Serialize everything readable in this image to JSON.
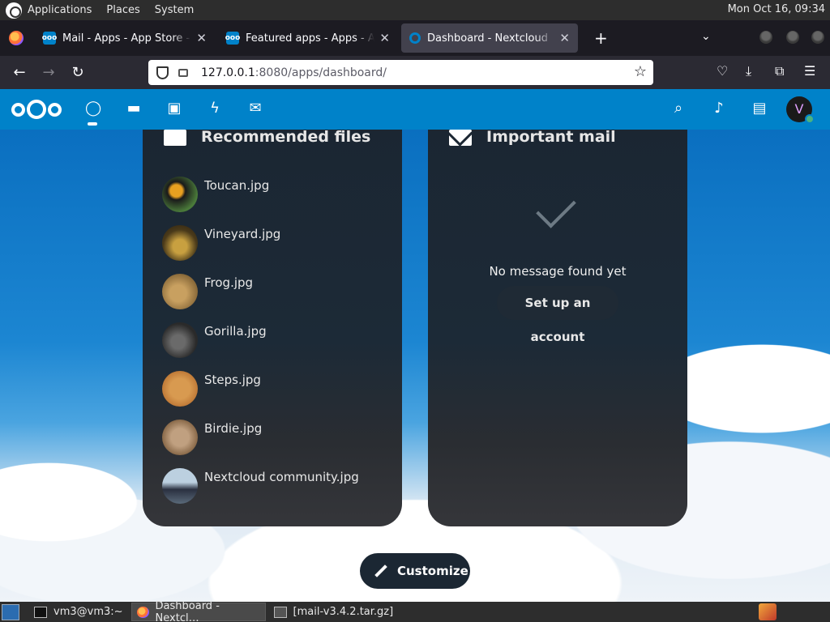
{
  "top_panel": {
    "menus": [
      "Applications",
      "Places",
      "System"
    ],
    "clock": "Mon Oct 16, 09:34"
  },
  "browser": {
    "tabs": [
      {
        "title": "Mail - Apps - App Store - Ne",
        "active": false
      },
      {
        "title": "Featured apps - Apps - Apps",
        "active": false
      },
      {
        "title": "Dashboard - Nextcloud",
        "active": true
      }
    ],
    "new_tab_icon": "+",
    "url_host": "127.0.0.1",
    "url_path": ":8080/apps/dashboard/"
  },
  "nextcloud": {
    "header_apps": [
      "dashboard-icon",
      "files-icon",
      "photos-icon",
      "activity-icon",
      "mail-icon"
    ],
    "avatar_initial": "V",
    "brand_color": "#0082c9"
  },
  "recommended_files": {
    "title": "Recommended files",
    "files": [
      {
        "name": "Toucan.jpg",
        "color": "#3b5a3a"
      },
      {
        "name": "Vineyard.jpg",
        "color": "#6b5a2a"
      },
      {
        "name": "Frog.jpg",
        "color": "#9a7a45"
      },
      {
        "name": "Gorilla.jpg",
        "color": "#3a3a3a"
      },
      {
        "name": "Steps.jpg",
        "color": "#c08040"
      },
      {
        "name": "Birdie.jpg",
        "color": "#a08060"
      },
      {
        "name": "Nextcloud community.jpg",
        "color": "#8a9aa8"
      }
    ]
  },
  "important_mail": {
    "title": "Important mail",
    "empty_message": "No message found yet",
    "setup_button": "Set up an account"
  },
  "customize_button": "Customize",
  "taskbar": {
    "items": [
      {
        "label": "vm3@vm3:~",
        "active": false
      },
      {
        "label": "Dashboard - Nextcl…",
        "active": true
      },
      {
        "label": "[mail-v3.4.2.tar.gz]",
        "active": false
      }
    ]
  }
}
